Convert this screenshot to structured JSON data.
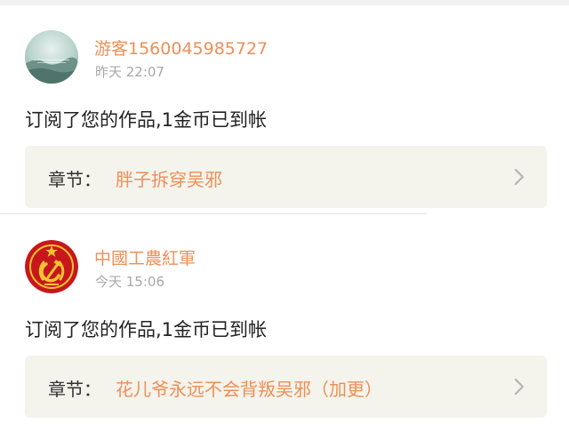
{
  "notifications": [
    {
      "username": "游客1560045985727",
      "timestamp": "昨天 22:07",
      "avatar_icon": "landscape-avatar",
      "message": "订阅了您的作品,1金币已到帐",
      "chapter_prefix": "章节：",
      "chapter_title": "胖子拆穿吴邪"
    },
    {
      "username": "中國工農紅軍",
      "timestamp": "今天 15:06",
      "avatar_icon": "hammer-sickle-emblem",
      "message": "订阅了您的作品,1金币已到帐",
      "chapter_prefix": "章节：",
      "chapter_title": "花儿爷永远不会背叛吴邪（加更）"
    }
  ],
  "colors": {
    "accent": "#ee8f57",
    "timestamp": "#a8a8a8",
    "card_background": "#f4f3ec",
    "message_text": "#222222"
  }
}
